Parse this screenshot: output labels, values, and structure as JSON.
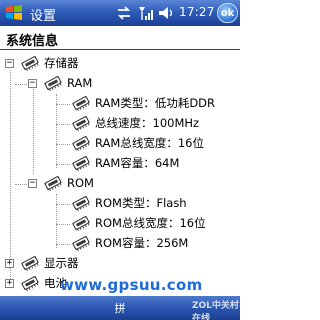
{
  "title_bar": {
    "app_title": "设置",
    "clock": "17:27",
    "ok_label": "ok",
    "icons": [
      "windows-start-icon",
      "sync-icon",
      "signal-icon",
      "volume-icon"
    ]
  },
  "page": {
    "title": "系统信息"
  },
  "tree": {
    "storage": {
      "label": "存储器",
      "expander": "−"
    },
    "ram": {
      "label": "RAM",
      "expander": "−",
      "items": [
        "RAM类型：低功耗DDR",
        "总线速度：100MHz",
        "RAM总线宽度：16位",
        "RAM容量：64M"
      ]
    },
    "rom": {
      "label": "ROM",
      "expander": "−",
      "items": [
        "ROM类型：Flash",
        "ROM总线宽度：16位",
        "ROM容量：256M"
      ]
    },
    "display": {
      "label": "显示器",
      "expander": "+"
    },
    "battery": {
      "label": "电池",
      "expander": "+"
    }
  },
  "softkeys": {
    "ime": "拼"
  },
  "watermark": {
    "url": "www.gpsuu.com",
    "site": "ZOL中关村在线"
  },
  "colors": {
    "bar_top": "#5b86d6",
    "bar_bottom": "#1b3f94",
    "watermark": "#1f6cd6"
  }
}
